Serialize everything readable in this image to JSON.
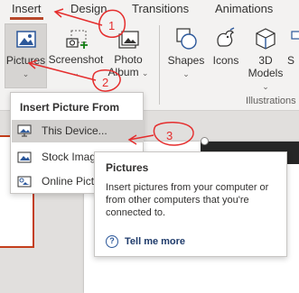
{
  "tabs": {
    "insert": "Insert",
    "design": "Design",
    "transitions": "Transitions",
    "animations": "Animations"
  },
  "ribbon": {
    "pictures_label": "Pictures",
    "screenshot_label": "Screenshot",
    "photo_album_label_1": "Photo",
    "photo_album_label_2": "Album",
    "shapes_label": "Shapes",
    "icons_label": "Icons",
    "models_label_1": "3D",
    "models_label_2": "Models",
    "cut_label": "S",
    "group_label": "Illustrations"
  },
  "dropdown": {
    "header": "Insert Picture From",
    "items": [
      {
        "label": "This Device...",
        "icon": "monitor-picture-icon"
      },
      {
        "label": "Stock Imag",
        "icon": "stock-images-icon"
      },
      {
        "label": "Online Pict",
        "icon": "online-pictures-icon"
      }
    ]
  },
  "tooltip": {
    "title": "Pictures",
    "description": "Insert pictures from your computer or from other computers that you're connected to.",
    "more_icon": "?",
    "more_label": "Tell me more"
  },
  "annotations": {
    "step1": "1",
    "step2": "2",
    "step3": "3"
  },
  "colors": {
    "accent": "#b7472a",
    "annotation": "#e52d2d",
    "link": "#2b579a"
  }
}
